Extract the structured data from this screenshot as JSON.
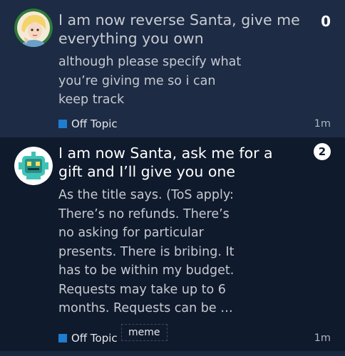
{
  "topics": [
    {
      "title": "I am now reverse Santa, give me everything you own",
      "excerpt": "although please specify what you’re giving me so i can keep track",
      "category": "Off Topic",
      "category_color": "#1e7dd0",
      "time": "1m",
      "reply_count": "0",
      "avatar_icon": "anime-character-avatar-icon"
    },
    {
      "title": "I am now Santa, ask me for a gift and I’ll give you one",
      "excerpt": "As the title says. (ToS apply: There’s no refunds. There’s no asking for particular presents. There is bribing. It has to be within my budget. Requests may take up to 6 months. Requests can be …",
      "category": "Off Topic",
      "category_color": "#1e7dd0",
      "tag": "meme",
      "time": "1m",
      "reply_count": "2",
      "avatar_icon": "robot-avatar-icon"
    }
  ]
}
